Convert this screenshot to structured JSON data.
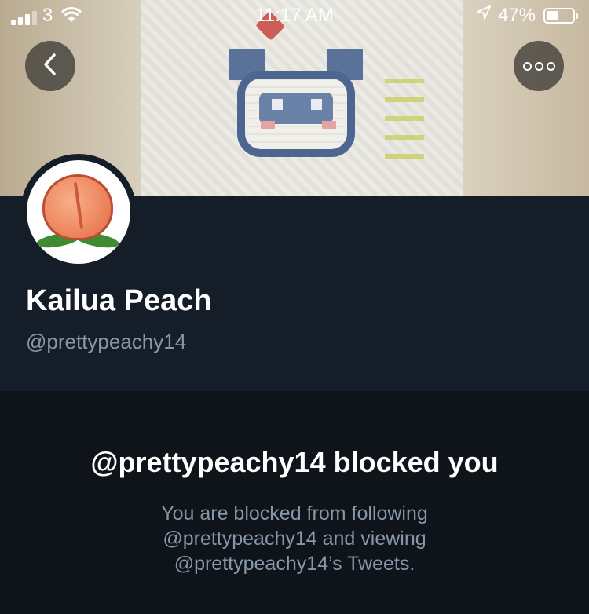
{
  "status_bar": {
    "carrier": "3",
    "time": "11:17 AM",
    "battery_percent": "47%",
    "battery_level": 0.47
  },
  "nav": {
    "back_icon": "chevron-left-icon",
    "more_icon": "more-horizontal-icon"
  },
  "profile": {
    "display_name": "Kailua Peach",
    "handle": "@prettypeachy14"
  },
  "blocked": {
    "title": "@prettypeachy14 blocked you",
    "description_lines": [
      "You are blocked from following",
      "@prettypeachy14 and viewing",
      "@prettypeachy14’s Tweets."
    ]
  },
  "colors": {
    "background": "#151d29",
    "blocked_background": "#0f141b",
    "secondary_text": "#8797a8"
  }
}
